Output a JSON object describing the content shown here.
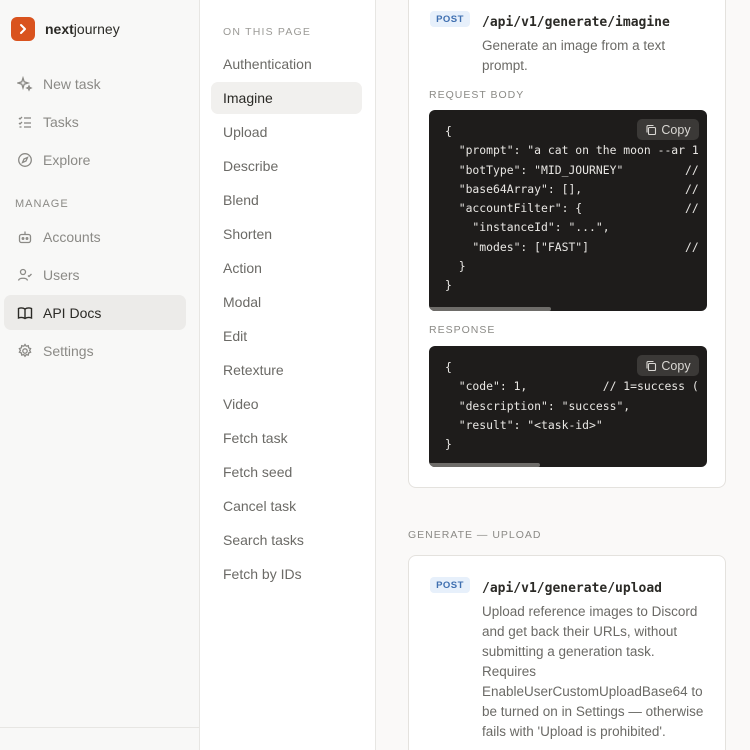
{
  "brand": {
    "bold": "next",
    "rest": "journey",
    "logo_color": "#d9531e"
  },
  "sidebar": {
    "nav": [
      {
        "label": "New task",
        "icon": "sparkle-icon"
      },
      {
        "label": "Tasks",
        "icon": "list-check-icon"
      },
      {
        "label": "Explore",
        "icon": "compass-icon"
      }
    ],
    "manage_label": "MANAGE",
    "manage": [
      {
        "label": "Accounts",
        "icon": "robot-icon"
      },
      {
        "label": "Users",
        "icon": "users-icon"
      },
      {
        "label": "API Docs",
        "icon": "book-icon",
        "active": true
      },
      {
        "label": "Settings",
        "icon": "gear-icon"
      }
    ]
  },
  "toc": {
    "label": "ON THIS PAGE",
    "items": [
      "Authentication",
      "Imagine",
      "Upload",
      "Describe",
      "Blend",
      "Shorten",
      "Action",
      "Modal",
      "Edit",
      "Retexture",
      "Video",
      "Fetch task",
      "Fetch seed",
      "Cancel task",
      "Search tasks",
      "Fetch by IDs"
    ],
    "active": "Imagine"
  },
  "imagine": {
    "method": "POST",
    "path": "/api/v1/generate/imagine",
    "description": "Generate an image from a text prompt.",
    "request_label": "REQUEST BODY",
    "request_code": "{\n  \"prompt\": \"a cat on the moon --ar 1\n  \"botType\": \"MID_JOURNEY\"         //\n  \"base64Array\": [],               //\n  \"accountFilter\": {               //\n    \"instanceId\": \"...\",\n    \"modes\": [\"FAST\"]              //\n  }\n}",
    "response_label": "RESPONSE",
    "response_code": "{\n  \"code\": 1,           // 1=success (\n  \"description\": \"success\",\n  \"result\": \"<task-id>\"\n}",
    "copy_label": "Copy"
  },
  "upload_section": {
    "heading": "GENERATE — UPLOAD",
    "method": "POST",
    "path": "/api/v1/generate/upload",
    "description": "Upload reference images to Discord and get back their URLs, without submitting a generation task. Requires EnableUserCustomUploadBase64 to be turned on in Settings — otherwise fails with 'Upload is prohibited'."
  }
}
